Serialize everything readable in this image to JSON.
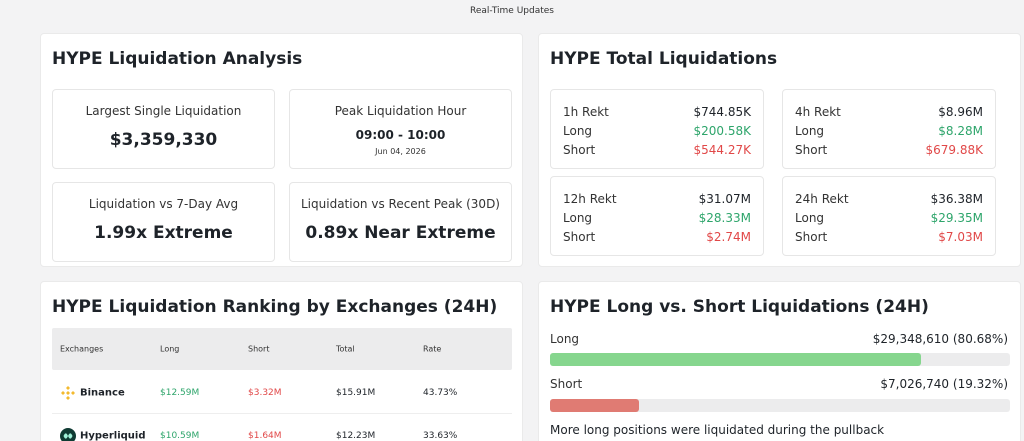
{
  "header": {
    "title": "Real-Time Updates"
  },
  "analysis": {
    "title": "HYPE Liquidation Analysis",
    "largest": {
      "label": "Largest Single Liquidation",
      "value": "$3,359,330"
    },
    "peak": {
      "label": "Peak Liquidation Hour",
      "value": "09:00 - 10:00",
      "date": "Jun 04, 2026"
    },
    "vs7day": {
      "label": "Liquidation vs 7-Day Avg",
      "value": "1.99x Extreme"
    },
    "vsPeak": {
      "label": "Liquidation vs Recent Peak (30D)",
      "value": "0.89x Near Extreme"
    }
  },
  "totals": {
    "title": "HYPE Total Liquidations",
    "blocks": [
      {
        "label": "1h Rekt",
        "total": "$744.85K",
        "long_label": "Long",
        "long": "$200.58K",
        "short_label": "Short",
        "short": "$544.27K"
      },
      {
        "label": "4h Rekt",
        "total": "$8.96M",
        "long_label": "Long",
        "long": "$8.28M",
        "short_label": "Short",
        "short": "$679.88K"
      },
      {
        "label": "12h Rekt",
        "total": "$31.07M",
        "long_label": "Long",
        "long": "$28.33M",
        "short_label": "Short",
        "short": "$2.74M"
      },
      {
        "label": "24h Rekt",
        "total": "$36.38M",
        "long_label": "Long",
        "long": "$29.35M",
        "short_label": "Short",
        "short": "$7.03M"
      }
    ]
  },
  "ranking": {
    "title": "HYPE Liquidation Ranking by Exchanges (24H)",
    "columns": [
      "Exchanges",
      "Long",
      "Short",
      "Total",
      "Rate"
    ],
    "rows": [
      {
        "exchange": "Binance",
        "long": "$12.59M",
        "short": "$3.32M",
        "total": "$15.91M",
        "rate": "43.73%",
        "icon": "binance-logo-icon"
      },
      {
        "exchange": "Hyperliquid",
        "long": "$10.59M",
        "short": "$1.64M",
        "total": "$12.23M",
        "rate": "33.63%",
        "icon": "hyperliquid-logo-icon"
      }
    ]
  },
  "longshort": {
    "title": "HYPE Long vs. Short Liquidations (24H)",
    "long_label": "Long",
    "long_value": "$29,348,610 (80.68%)",
    "long_pct": 80.68,
    "short_label": "Short",
    "short_value": "$7,026,740 (19.32%)",
    "short_pct": 19.32,
    "note": "More long positions were liquidated during the pullback",
    "colors": {
      "long": "#86d68e",
      "short": "#e07b73"
    }
  }
}
